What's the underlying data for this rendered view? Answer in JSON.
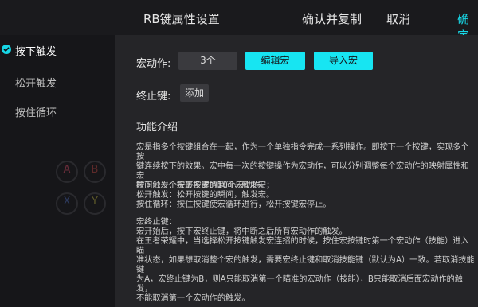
{
  "header": {
    "title": "RB键属性设置",
    "copy_label": "确认并复制",
    "cancel_label": "取消",
    "confirm_label": "确定"
  },
  "sidebar": {
    "items": [
      {
        "label": "按下触发",
        "selected": true
      },
      {
        "label": "松开触发",
        "selected": false
      },
      {
        "label": "按住循环",
        "selected": false
      }
    ]
  },
  "background_pad": {
    "buttons": [
      "A",
      "B",
      "X",
      "Y"
    ],
    "colors": {
      "A": "#6a2d3a",
      "B": "#5e2a2a",
      "X": "#2d3a5e",
      "Y": "#5e5a2a"
    }
  },
  "macro": {
    "label": "宏动作:",
    "count_value": "3个",
    "edit_label": "编辑宏",
    "import_label": "导入宏"
  },
  "stop_key": {
    "label": "终止键:",
    "add_label": "添加"
  },
  "intro": {
    "title": "功能介绍",
    "p1_l1": "宏是指多个按键组合在一起，作为一个单独指令完成一系列操作。即按下一个按键，实现多个按",
    "p1_l2": "键连续按下的效果。宏中每一次的按键操作为宏动作，可以分别调整每个宏动作的映射属性和宏",
    "p1_l3": "时间，一个宏最多支持10个宏动作。",
    "p2_l1": "按下触发：按下按键的瞬间，触发宏；",
    "p2_l2": "松开触发：松开按键的瞬间，触发宏。",
    "p2_l3": "按住循环：按住按键使宏循环进行，松开按键宏停止。",
    "p3_l1": "宏终止键：",
    "p3_l2": "宏开始后，按下宏终止键，将中断之后所有宏动作的触发。",
    "p3_l3": "在王者荣耀中，当选择松开按键触发宏连招的时候，按住宏按键时第一个宏动作（技能）进入瞄",
    "p3_l4": "准状态，如果想取消整个宏的触发，需要宏终止键和取消技能键（默认为A）一致。若取消技能键",
    "p3_l5": "为A，宏终止键为B，则A只能取消第一个瞄准的宏动作（技能），B只能取消后面宏动作的触发，",
    "p3_l6": "不能取消第一个宏动作的触发。"
  },
  "colors": {
    "accent": "#17e5f2",
    "panel": "#252528",
    "sidebar": "#161619"
  }
}
